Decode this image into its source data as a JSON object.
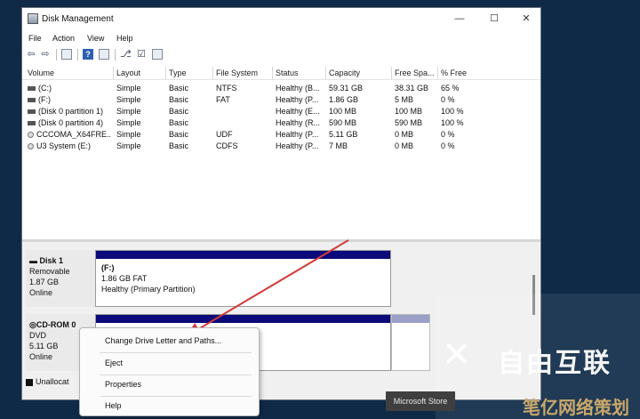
{
  "window": {
    "title": "Disk Management"
  },
  "window_controls": {
    "minimize": "—",
    "maximize": "☐",
    "close": "✕"
  },
  "menu": [
    "File",
    "Action",
    "View",
    "Help"
  ],
  "volume_list": {
    "columns": [
      "Volume",
      "Layout",
      "Type",
      "File System",
      "Status",
      "Capacity",
      "Free Spa...",
      "% Free"
    ],
    "rows": [
      [
        "(C:)",
        "Simple",
        "Basic",
        "NTFS",
        "Healthy (B...",
        "59.31 GB",
        "38.31 GB",
        "65 %"
      ],
      [
        "(F:)",
        "Simple",
        "Basic",
        "FAT",
        "Healthy (P...",
        "1.86 GB",
        "5 MB",
        "0 %"
      ],
      [
        "(Disk 0 partition 1)",
        "Simple",
        "Basic",
        "",
        "Healthy (E...",
        "100 MB",
        "100 MB",
        "100 %"
      ],
      [
        "(Disk 0 partition 4)",
        "Simple",
        "Basic",
        "",
        "Healthy (R...",
        "590 MB",
        "590 MB",
        "100 %"
      ],
      [
        "CCCOMA_X64FRE...",
        "Simple",
        "Basic",
        "UDF",
        "Healthy (P...",
        "5.11 GB",
        "0 MB",
        "0 %"
      ],
      [
        "U3 System (E:)",
        "Simple",
        "Basic",
        "CDFS",
        "Healthy (P...",
        "7 MB",
        "0 MB",
        "0 %"
      ]
    ]
  },
  "disk1": {
    "name": "Disk 1",
    "type": "Removable",
    "size": "1.87 GB",
    "status": "Online"
  },
  "disk1_volume": {
    "letter": "(F:)",
    "info": "1.86 GB FAT",
    "status": "Healthy (Primary Partition)"
  },
  "cdrom0": {
    "name": "CD-ROM 0",
    "type": "DVD",
    "size": "5.11 GB",
    "status": "Online"
  },
  "legend": {
    "unallocated": "Unallocat"
  },
  "context_menu": {
    "items": [
      "Change Drive Letter and Paths...",
      "Eject",
      "Properties",
      "Help"
    ]
  },
  "badge": {
    "store": "Microsoft Store"
  },
  "watermark": {
    "main": "自由互联",
    "sub": "笔亿网络策划"
  },
  "colors": {
    "volume_bar": "#0a0a7a",
    "arrow": "#d23b3b",
    "background": "#0f2a47"
  }
}
